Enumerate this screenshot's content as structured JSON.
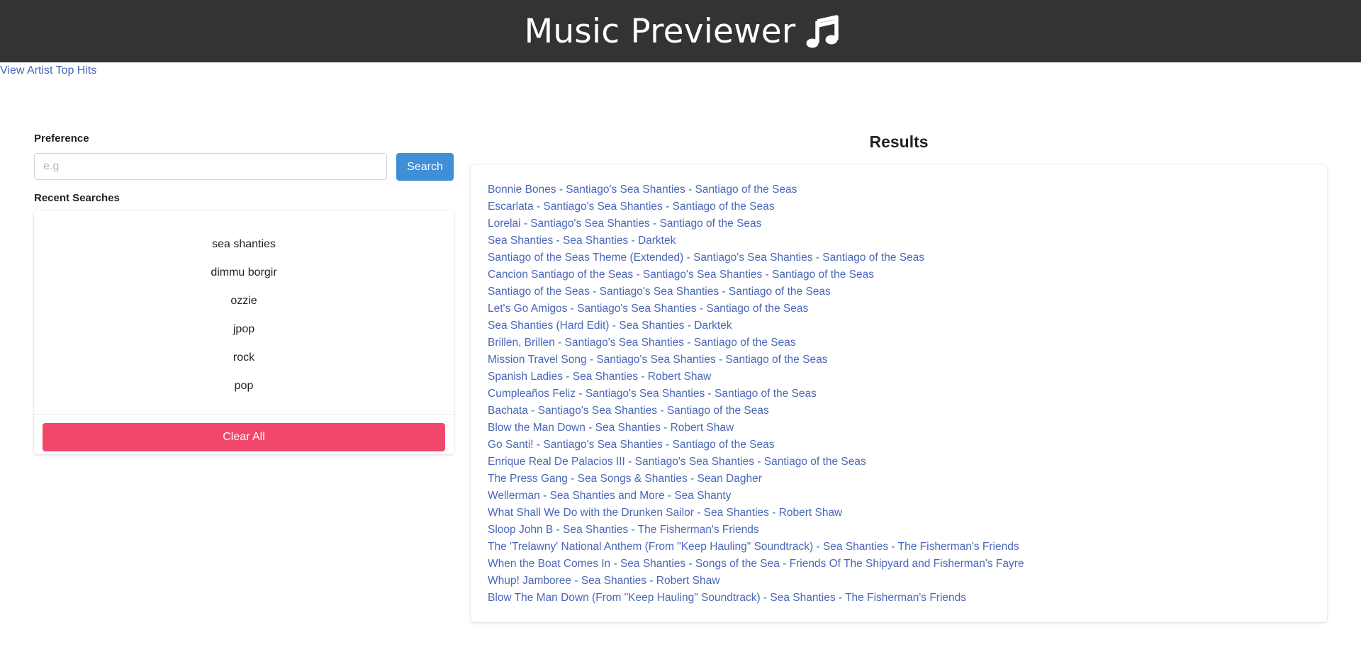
{
  "header": {
    "title": "Music Previewer",
    "icon": "music-note-icon",
    "background_color": "#333333"
  },
  "nav": {
    "top_hits_link": "View Artist Top Hits"
  },
  "search": {
    "label": "Preference",
    "placeholder": "e.g",
    "value": "",
    "button_label": "Search",
    "button_color": "#3f8ed6"
  },
  "recent": {
    "label": "Recent Searches",
    "items": [
      "sea shanties",
      "dimmu borgir",
      "ozzie",
      "jpop",
      "rock",
      "pop"
    ],
    "clear_label": "Clear All",
    "clear_color": "#f1476b"
  },
  "results": {
    "title": "Results",
    "link_color": "#4a67b8",
    "items": [
      "Bonnie Bones - Santiago's Sea Shanties - Santiago of the Seas",
      "Escarlata - Santiago's Sea Shanties - Santiago of the Seas",
      "Lorelai - Santiago's Sea Shanties - Santiago of the Seas",
      "Sea Shanties - Sea Shanties - Darktek",
      "Santiago of the Seas Theme (Extended) - Santiago's Sea Shanties - Santiago of the Seas",
      "Cancion Santiago of the Seas - Santiago's Sea Shanties - Santiago of the Seas",
      "Santiago of the Seas - Santiago's Sea Shanties - Santiago of the Seas",
      "Let's Go Amigos - Santiago's Sea Shanties - Santiago of the Seas",
      "Sea Shanties (Hard Edit) - Sea Shanties - Darktek",
      "Brillen, Brillen - Santiago's Sea Shanties - Santiago of the Seas",
      "Mission Travel Song - Santiago's Sea Shanties - Santiago of the Seas",
      "Spanish Ladies - Sea Shanties - Robert Shaw",
      "Cumpleaños Feliz - Santiago's Sea Shanties - Santiago of the Seas",
      "Bachata - Santiago's Sea Shanties - Santiago of the Seas",
      "Blow the Man Down - Sea Shanties - Robert Shaw",
      "Go Santi! - Santiago's Sea Shanties - Santiago of the Seas",
      "Enrique Real De Palacios III - Santiago's Sea Shanties - Santiago of the Seas",
      "The Press Gang - Sea Songs & Shanties - Sean Dagher",
      "Wellerman - Sea Shanties and More - Sea Shanty",
      "What Shall We Do with the Drunken Sailor - Sea Shanties - Robert Shaw",
      "Sloop John B - Sea Shanties - The Fisherman's Friends",
      "The 'Trelawny' National Anthem (From \"Keep Hauling\" Soundtrack) - Sea Shanties - The Fisherman's Friends",
      "When the Boat Comes In - Sea Shanties - Songs of the Sea - Friends Of The Shipyard and Fisherman's Fayre",
      "Whup! Jamboree - Sea Shanties - Robert Shaw",
      "Blow The Man Down (From \"Keep Hauling\" Soundtrack) - Sea Shanties - The Fisherman's Friends"
    ]
  }
}
